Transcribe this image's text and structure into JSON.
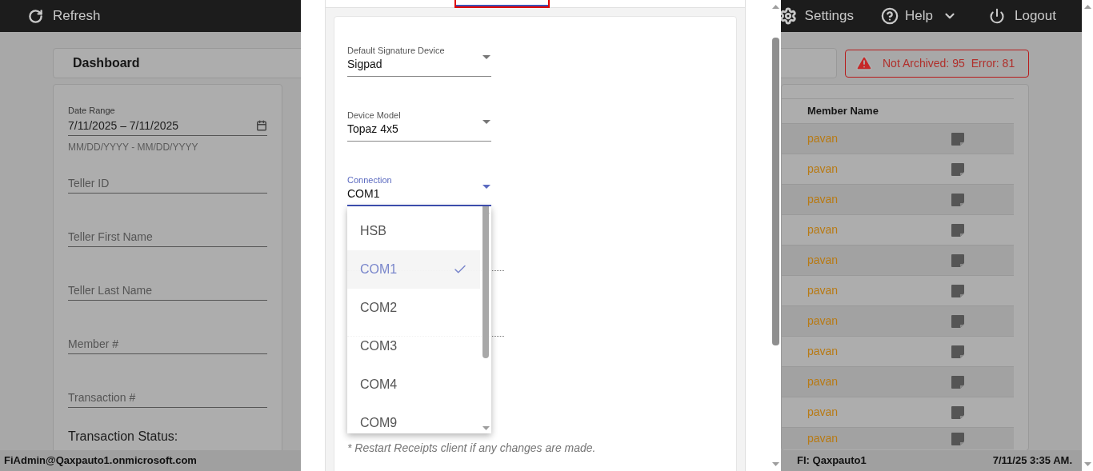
{
  "top_bar": {
    "refresh": "Refresh",
    "settings": "Settings",
    "help": "Help",
    "logout": "Logout"
  },
  "dashboard": {
    "title": "Dashboard",
    "alert": [
      "Not Archived: 95",
      "Error: 81"
    ]
  },
  "filters": {
    "date_range": {
      "label": "Date Range",
      "value": "7/11/2025 – 7/11/2025",
      "helper": "MM/DD/YYYY - MM/DD/YYYY"
    },
    "fields": [
      {
        "placeholder": "Teller ID"
      },
      {
        "placeholder": "Teller First Name"
      },
      {
        "placeholder": "Teller Last Name"
      },
      {
        "placeholder": "Member #"
      },
      {
        "placeholder": "Transaction #"
      }
    ],
    "status_label": "Transaction Status:"
  },
  "table": {
    "column_header": "Member Name",
    "rows": [
      {
        "member_name": "pavan"
      },
      {
        "member_name": "pavan"
      },
      {
        "member_name": "pavan"
      },
      {
        "member_name": "pavan"
      },
      {
        "member_name": "pavan"
      },
      {
        "member_name": "pavan"
      },
      {
        "member_name": "pavan"
      },
      {
        "member_name": "pavan"
      },
      {
        "member_name": "pavan"
      },
      {
        "member_name": "pavan"
      },
      {
        "member_name": "pavan"
      }
    ]
  },
  "status_bar": {
    "user": "FiAdmin@Qaxpauto1.onmicrosoft.com",
    "fi": "FI: Qaxpauto1",
    "time": "7/11/25 3:35 AM."
  },
  "dialog": {
    "tabs": [
      {
        "selected": true
      }
    ],
    "selects": [
      {
        "label": "Default Signature Device",
        "value": "Sigpad",
        "focused": false
      },
      {
        "label": "Device Model",
        "value": "Topaz 4x5",
        "focused": false
      },
      {
        "label": "Connection",
        "value": "COM1",
        "focused": true
      }
    ],
    "menu": {
      "options": [
        {
          "label": "HSB",
          "selected": false
        },
        {
          "label": "COM1",
          "selected": true
        },
        {
          "label": "COM2",
          "selected": false
        },
        {
          "label": "COM3",
          "selected": false
        },
        {
          "label": "COM4",
          "selected": false
        },
        {
          "label": "COM9",
          "selected": false
        }
      ]
    },
    "note": "* Restart Receipts client if any changes are made."
  }
}
